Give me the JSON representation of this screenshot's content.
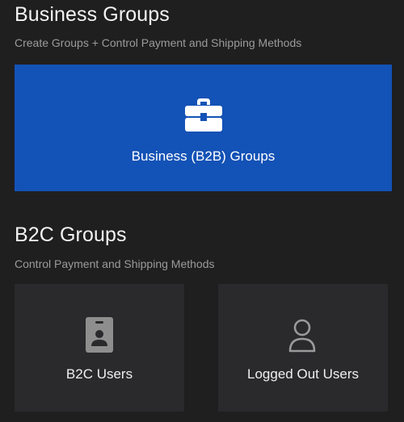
{
  "business": {
    "title": "Business Groups",
    "subtitle": "Create Groups + Control Payment and Shipping Methods",
    "card_label": "Business (B2B) Groups",
    "card_icon": "briefcase-icon",
    "card_color": "#1352b6"
  },
  "b2c": {
    "title": "B2C Groups",
    "subtitle": "Control Payment and Shipping Methods",
    "cards": [
      {
        "label": "B2C Users",
        "icon": "id-badge-icon"
      },
      {
        "label": "Logged Out Users",
        "icon": "user-outline-icon"
      }
    ]
  },
  "colors": {
    "background": "#1f1f20",
    "card_background": "#2a2a2d",
    "subtitle_text": "#9b9b9b",
    "icon_muted": "#9a9a9a"
  }
}
